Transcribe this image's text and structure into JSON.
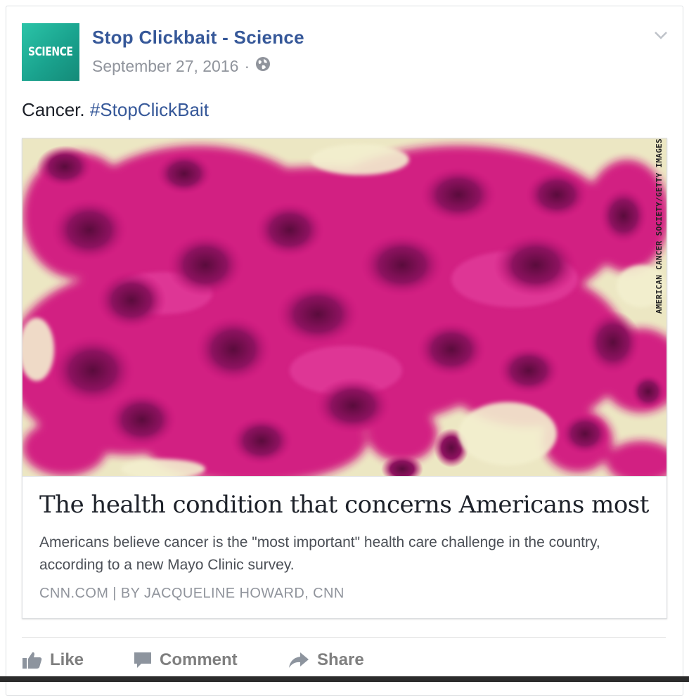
{
  "post": {
    "avatar_text": "SCIENCE",
    "page_name": "Stop Clickbait - Science",
    "date": "September 27, 2016",
    "separator": "·",
    "caption_text": "Cancer.",
    "caption_hashtag": "#StopClickBait"
  },
  "card": {
    "image_credit": "AMERICAN CANCER SOCIETY/GETTY IMAGES",
    "headline": "The health condition that concerns Americans most",
    "description": "Americans believe cancer is the \"most important\" health care challenge in the country, according to a new Mayo Clinic survey.",
    "source": "CNN.COM  |  BY JACQUELINE HOWARD, CNN"
  },
  "actions": {
    "like": "Like",
    "comment": "Comment",
    "share": "Share"
  },
  "icons": {
    "privacy": "globe-icon",
    "menu": "chevron-down-icon",
    "like": "thumbs-up-icon",
    "comment": "speech-bubble-icon",
    "share": "share-arrow-icon"
  },
  "colors": {
    "link": "#365899",
    "muted": "#90949c",
    "avatar": "#1fb39b",
    "cell_magenta": "#d1157f"
  }
}
